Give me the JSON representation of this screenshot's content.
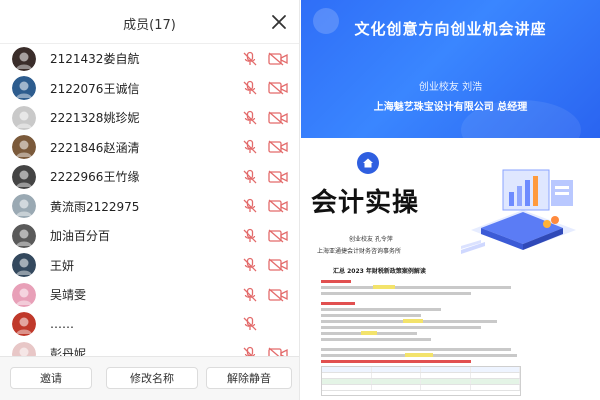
{
  "panel": {
    "title": "成员(17)",
    "members": [
      {
        "name": "2121432娄自航",
        "avatar_color": "#3a2d2a"
      },
      {
        "name": "2122076王诚信",
        "avatar_color": "#2d5c8e"
      },
      {
        "name": "2221328姚珍妮",
        "avatar_color": "#c9c9c9"
      },
      {
        "name": "2221846赵涵清",
        "avatar_color": "#7b5a3b"
      },
      {
        "name": "2222966王竹缘",
        "avatar_color": "#444444"
      },
      {
        "name": "黄流雨2122975",
        "avatar_color": "#9aa9b3"
      },
      {
        "name": "加油百分百",
        "avatar_color": "#5a5a5a"
      },
      {
        "name": "王妍",
        "avatar_color": "#34495e"
      },
      {
        "name": "吴靖雯",
        "avatar_color": "#e8a0b8"
      },
      {
        "name": "……",
        "avatar_color": "#c0392b"
      },
      {
        "name": "彭丹妮",
        "avatar_color": "#e8c7c7"
      }
    ],
    "footer": {
      "invite_label": "邀请",
      "rename_label": "修改名称",
      "unmute_label": "解除静音"
    },
    "icons": {
      "close": "close-icon",
      "mic": "mic-muted-icon",
      "camera": "camera-off-icon"
    },
    "colors": {
      "muted_icon": "#e36b6b"
    }
  },
  "slide_top": {
    "title": "文化创意方向创业机会讲座",
    "speaker": "创业校友    刘浩",
    "company": "上海魅艺珠宝设计有限公司  总经理",
    "bg_color": "#2f6ef7"
  },
  "slide_bottom": {
    "heading": "会计实操",
    "line1": "创业校友  孔令萍",
    "line2": "上海亚通捷会计财务咨询事务所",
    "doc_title": "汇总 2023 年财税新政策案例解读"
  }
}
